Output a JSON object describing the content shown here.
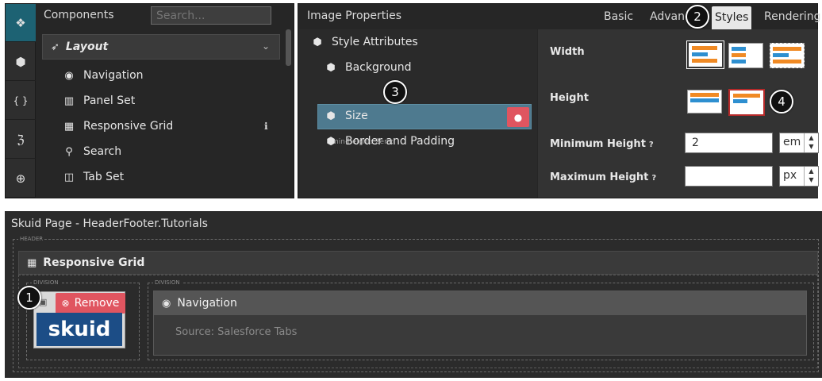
{
  "left_panel": {
    "rail_icons": [
      "components-icon",
      "model-icon",
      "braces-icon",
      "css-icon",
      "globe-icon"
    ],
    "rail_glyphs": [
      "❖",
      "⬢",
      "{ }",
      "ℨ",
      "⊕"
    ],
    "title": "Components",
    "search_placeholder": "Search...",
    "group_label": "Layout",
    "items": [
      {
        "label": "Navigation",
        "icon": "compass-icon",
        "glyph": "◉"
      },
      {
        "label": "Panel Set",
        "icon": "panel-set-icon",
        "glyph": "▥"
      },
      {
        "label": "Responsive Grid",
        "icon": "grid-icon",
        "glyph": "▦"
      },
      {
        "label": "Search",
        "icon": "search-icon",
        "glyph": "⚲"
      },
      {
        "label": "Tab Set",
        "icon": "tab-set-icon",
        "glyph": "◫"
      }
    ],
    "info_glyph": "ℹ"
  },
  "right_panel": {
    "title": "Image Properties",
    "tabs": [
      "Basic",
      "Advanc",
      "Styles",
      "Rendering"
    ],
    "active_tab": "Styles",
    "attributes": {
      "header": "Style Attributes",
      "items": [
        "Background",
        "Size",
        "Border and Padding"
      ],
      "size_css": "min-height: 2em;"
    },
    "options": {
      "width_label": "Width",
      "height_label": "Height",
      "min_height_label": "Minimum Height",
      "min_height_value": "2",
      "min_height_unit": "em",
      "max_height_label": "Maximum Height",
      "max_height_value": "",
      "max_height_unit": "px"
    }
  },
  "page": {
    "title": "Skuid Page - HeaderFooter.Tutorials",
    "header_region": "HEADER",
    "grid_label": "Responsive Grid",
    "division_label": "DIVISION",
    "remove_label": "Remove",
    "logo_text": "skuid",
    "nav_label": "Navigation",
    "nav_source": "Source: Salesforce Tabs"
  },
  "callouts": [
    "1",
    "2",
    "3",
    "4"
  ],
  "colors": {
    "accent_teal": "#1d6273",
    "selected_row": "#4e7a8f",
    "remove_red": "#e05560",
    "swatch_orange": "#f08a24",
    "swatch_blue": "#2e8fd0",
    "logo_blue": "#1c4d86"
  }
}
